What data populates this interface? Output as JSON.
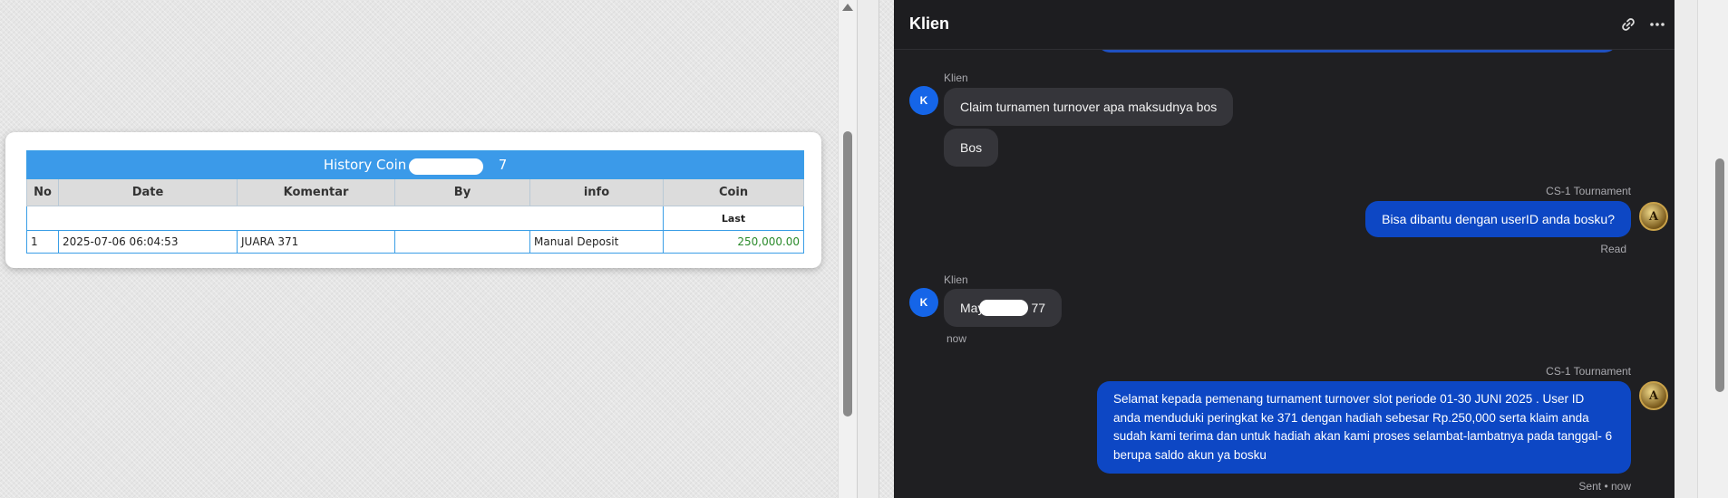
{
  "history": {
    "title_prefix": "History Coin m",
    "title_suffix": "7",
    "columns": [
      "No",
      "Date",
      "Komentar",
      "By",
      "info",
      "Coin"
    ],
    "subheader_coin": "Last",
    "rows": [
      {
        "no": "1",
        "date": "2025-07-06 06:04:53",
        "komentar": "JUARA 371",
        "by": "",
        "info": "Manual Deposit",
        "coin": "250,000.00"
      }
    ]
  },
  "chat": {
    "title": "Klien",
    "messages": {
      "m1_sender": "Klien",
      "m1_avatar": "K",
      "m1_text": "Claim turnamen turnover apa maksudnya bos",
      "m2_text": "Bos",
      "m3_sender": "CS-1 Tournament",
      "m3_text": "Bisa dibantu dengan userID anda bosku?",
      "m3_status": "Read",
      "m4_sender": "Klien",
      "m4_avatar": "K",
      "m4_text_prefix": "May",
      "m4_text_suffix": "77",
      "m4_time": "now",
      "m5_sender": "CS-1 Tournament",
      "m5_text": "Selamat kepada pemenang turnament turnover slot periode 01-30 JUNI 2025 . User ID anda menduduki peringkat ke 371 dengan hadiah sebesar Rp.250,000 serta klaim anda sudah kami terima dan untuk hadiah akan kami proses selambat-lambatnya pada tanggal- 6 berupa saldo akun ya bosku",
      "m5_status": "Sent • now"
    },
    "agent_avatar_letter": "A",
    "colors": {
      "outgoing": "#0d47c4",
      "incoming": "#35353a",
      "background": "#1f1f22",
      "avatar": "#1565e8"
    },
    "icons": {
      "link": "link-icon",
      "more": "more-icon"
    }
  }
}
